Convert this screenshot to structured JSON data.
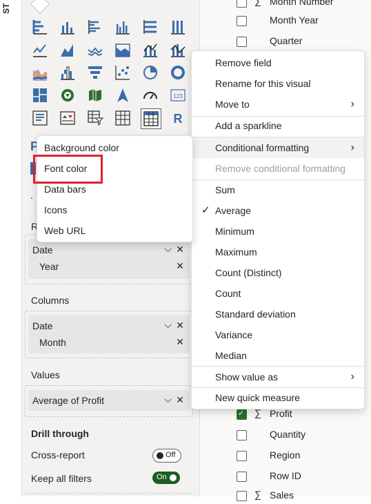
{
  "left_strip_text": "ST",
  "visual_icons": [
    "stacked-bar-chart-icon",
    "stacked-column-chart-icon",
    "clustered-bar-chart-icon",
    "clustered-column-chart-icon",
    "100pct-stacked-bar-chart-icon",
    "100pct-stacked-column-chart-icon",
    "line-chart-icon",
    "area-chart-icon",
    "stacked-area-chart-icon",
    "line-and-stacked-column-icon",
    "line-and-clustered-column-icon",
    "ribbon-chart-icon",
    "waterfall-chart-icon",
    "funnel-chart-icon",
    "scatter-chart-icon",
    "pie-chart-icon",
    "donut-chart-icon",
    "treemap-icon",
    "map-icon",
    "filled-map-icon",
    "azure-map-icon",
    "gauge-icon",
    "card-icon",
    "multi-row-card-icon",
    "kpi-icon",
    "slicer-icon",
    "table-icon",
    "matrix-icon",
    "r-visual-icon"
  ],
  "viz_pane": {
    "rows_label": "R",
    "rows_well": {
      "group": "Date",
      "item": "Year"
    },
    "columns_label": "Columns",
    "columns_well": {
      "group": "Date",
      "item": "Month"
    },
    "values_label": "Values",
    "values_well": {
      "item": "Average of Profit"
    },
    "drill_through_label": "Drill through",
    "cross_report_label": "Cross-report",
    "cross_report_toggle": "Off",
    "keep_filters_label": "Keep all filters",
    "keep_filters_toggle": "On"
  },
  "fields": {
    "top": [
      {
        "label": "Month Number",
        "sigma": true,
        "checked": false
      },
      {
        "label": "Month Year",
        "sigma": false,
        "checked": false
      },
      {
        "label": "Quarter",
        "sigma": false,
        "checked": false
      }
    ],
    "bottom": [
      {
        "label": "Profit",
        "sigma": true,
        "checked": true
      },
      {
        "label": "Quantity",
        "sigma": false,
        "checked": false
      },
      {
        "label": "Region",
        "sigma": false,
        "checked": false
      },
      {
        "label": "Row ID",
        "sigma": false,
        "checked": false
      },
      {
        "label": "Sales",
        "sigma": true,
        "checked": false
      }
    ]
  },
  "context_menu": {
    "items": [
      "Remove field",
      "Rename for this visual",
      "Move to",
      "Add a sparkline",
      "Conditional formatting",
      "Remove conditional formatting",
      "Sum",
      "Average",
      "Minimum",
      "Maximum",
      "Count (Distinct)",
      "Count",
      "Standard deviation",
      "Variance",
      "Median",
      "Show value as",
      "New quick measure"
    ]
  },
  "submenu": {
    "items": [
      "Background color",
      "Font color",
      "Data bars",
      "Icons",
      "Web URL"
    ]
  },
  "colors": {
    "highlight_box": "#d9232e",
    "toggle_on": "#1b5e20",
    "icon_blue": "#3b6ea8",
    "icon_green": "#2b6f2b"
  }
}
